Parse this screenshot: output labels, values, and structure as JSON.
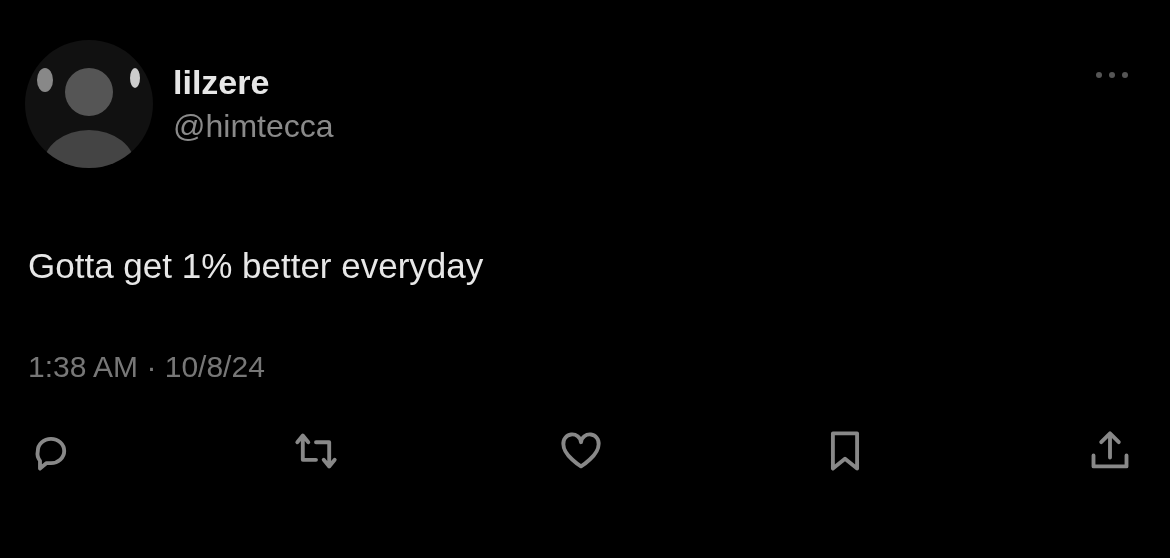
{
  "author": {
    "name": "lilzere",
    "handle": "@himtecca"
  },
  "tweet": {
    "text": "Gotta get 1% better everyday",
    "timestamp": "1:38 AM · 10/8/24"
  },
  "actions": [
    {
      "kind": "reply"
    },
    {
      "kind": "retweet"
    },
    {
      "kind": "like"
    },
    {
      "kind": "bookmark"
    },
    {
      "kind": "share"
    }
  ]
}
